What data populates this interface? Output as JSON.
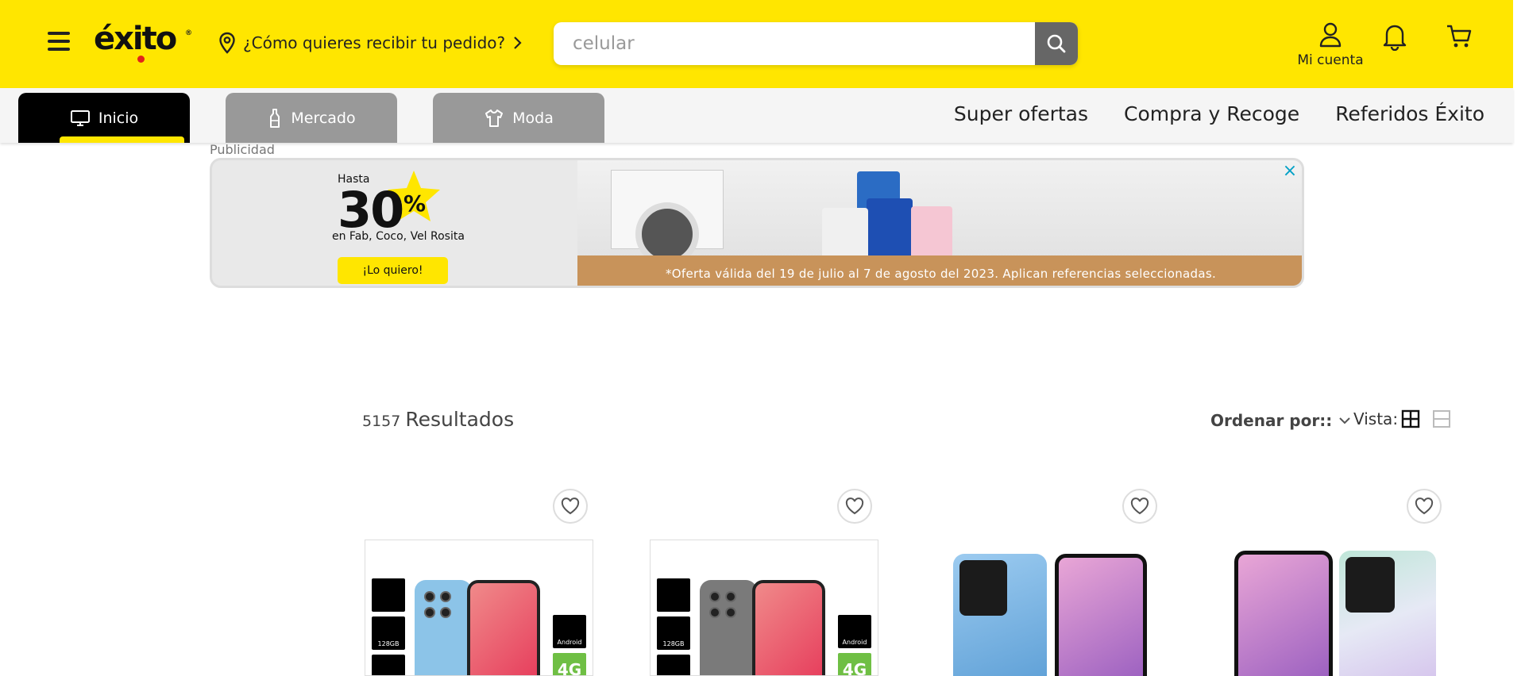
{
  "header": {
    "logo": "éxito",
    "delivery_prompt": "¿Cómo quieres recibir tu pedido?",
    "search_value": "",
    "search_placeholder": "celular",
    "account_label": "Mi cuenta"
  },
  "nav": {
    "tabs": [
      {
        "label": "Inicio",
        "active": true
      },
      {
        "label": "Mercado",
        "active": false
      },
      {
        "label": "Moda",
        "active": false
      }
    ],
    "links": [
      "Super ofertas",
      "Compra y Recoge",
      "Referidos Éxito"
    ]
  },
  "ad": {
    "label": "Publicidad",
    "hasta": "Hasta",
    "discount": "30",
    "percent": "%",
    "brands": "en Fab, Coco, Vel Rosita",
    "cta": "¡Lo quiero!",
    "terms": "*Oferta válida del 19 de julio al 7 de agosto del 2023. Aplican referencias seleccionadas.",
    "close_icon": "×"
  },
  "results": {
    "count": "5157",
    "label": "Resultados",
    "sort_label": "Ordenar por::",
    "view_label": "Vista:"
  },
  "product_badges": {
    "storage": "128GB",
    "os": "Android",
    "network": "4G"
  },
  "colors": {
    "brand_yellow": "#ffe600",
    "tab_active": "#000000",
    "tab_inactive": "#999999",
    "search_button": "#666666"
  }
}
